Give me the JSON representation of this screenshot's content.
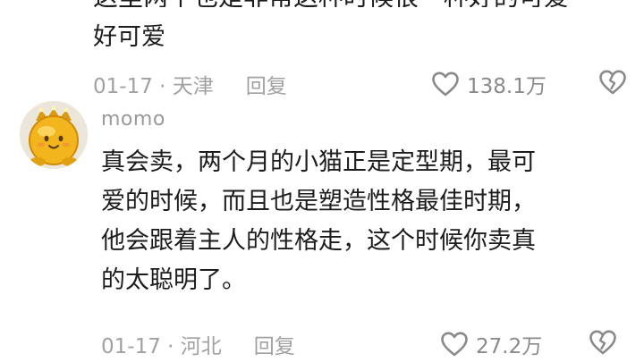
{
  "previous_comment": {
    "text_tail": "好可爱",
    "date": "01-17",
    "location": "天津",
    "reply_label": "回复",
    "like_count": "138.1万"
  },
  "comment": {
    "username": "momo",
    "lines": [
      "真会卖，两个月的小猫正是定型期，最可",
      "爱的时候，而且也是塑造性格最佳时期，",
      "他会跟着主人的性格走，这个时候你卖真",
      "的太聪明了。"
    ],
    "date": "01-17",
    "location": "河北",
    "reply_label": "回复",
    "like_count": "27.2万"
  },
  "icons": {
    "like": "heart-outline-icon",
    "dislike": "broken-heart-icon"
  },
  "colors": {
    "text": "#1c1c1c",
    "meta": "#a1a1a1",
    "icon": "#8a8a8a",
    "avatar_gold": "#f2b51d"
  }
}
